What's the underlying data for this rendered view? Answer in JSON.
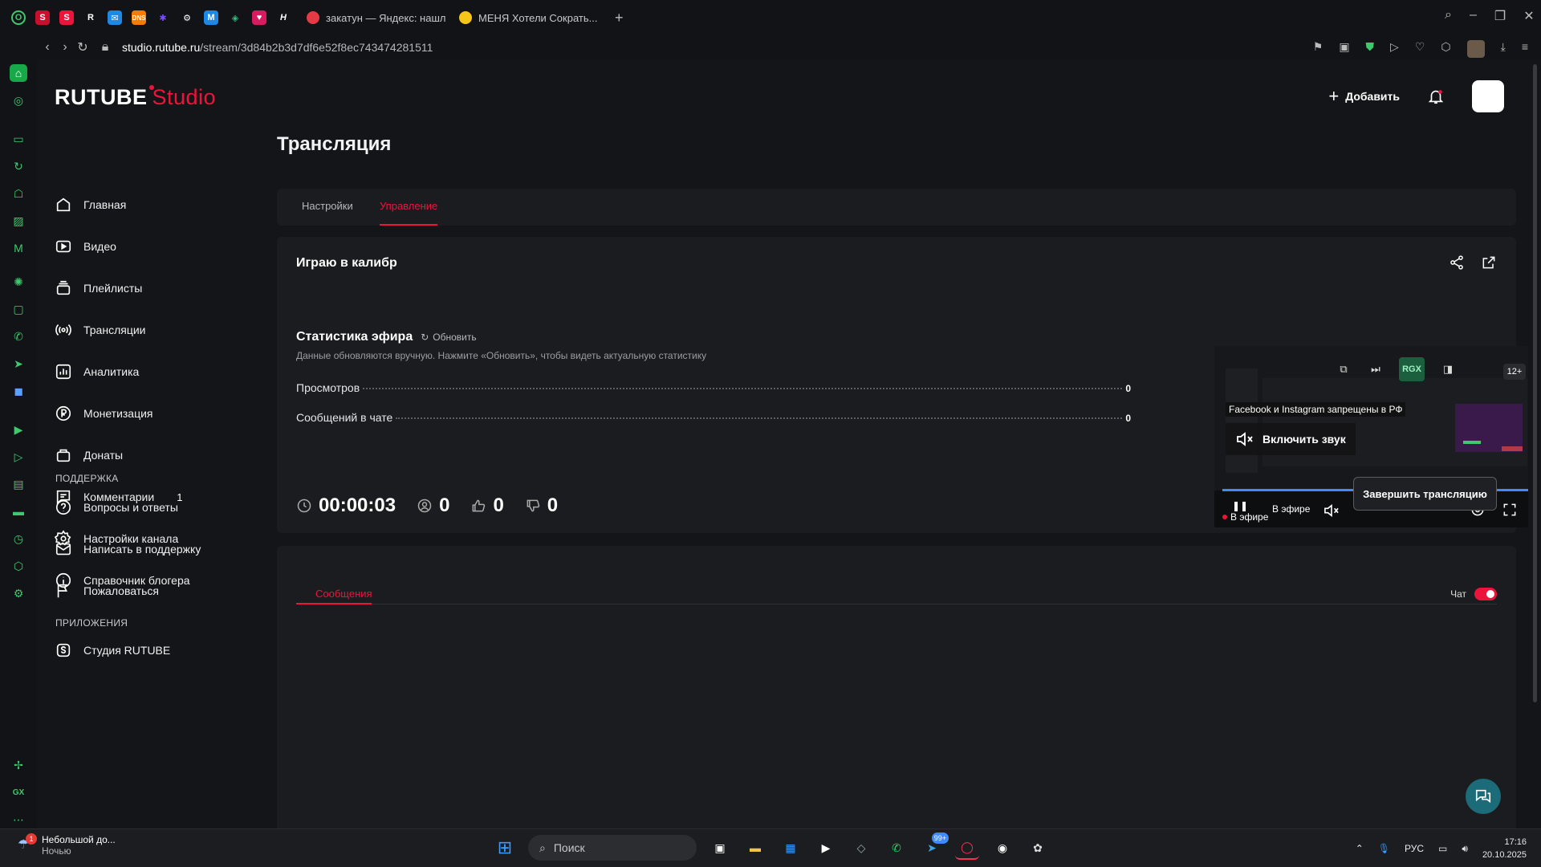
{
  "browser": {
    "tabs": [
      {
        "label": "закатун — Яндекс: нашл",
        "color": "#e63946"
      },
      {
        "label": "МЕНЯ Хотели Сократь...",
        "color": "#f5c518"
      }
    ],
    "url_domain": "studio.rutube.ru",
    "url_path": "/stream/3d84b2b3d7df6e52f8ec743474281511"
  },
  "brand": {
    "name": "RUTUBE",
    "suffix": "Studio",
    "accent": "#ed143b"
  },
  "header": {
    "add_label": "Добавить"
  },
  "sidebar": {
    "items": [
      {
        "label": "Главная",
        "icon": "home-icon"
      },
      {
        "label": "Видео",
        "icon": "video-icon"
      },
      {
        "label": "Плейлисты",
        "icon": "playlist-icon"
      },
      {
        "label": "Трансляции",
        "icon": "broadcast-icon"
      },
      {
        "label": "Аналитика",
        "icon": "analytics-icon"
      },
      {
        "label": "Монетизация",
        "icon": "money-icon"
      },
      {
        "label": "Донаты",
        "icon": "donate-icon"
      },
      {
        "label": "Комментарии",
        "icon": "comment-icon",
        "badge": "1"
      },
      {
        "label": "Настройки канала",
        "icon": "gear-icon"
      },
      {
        "label": "Справочник блогера",
        "icon": "info-icon"
      }
    ],
    "support_title": "ПОДДЕРЖКА",
    "support_items": [
      {
        "label": "Вопросы и ответы",
        "icon": "question-icon"
      },
      {
        "label": "Написать в поддержку",
        "icon": "mail-icon"
      },
      {
        "label": "Пожаловаться",
        "icon": "flag-icon"
      }
    ],
    "apps_title": "ПРИЛОЖЕНИЯ",
    "apps_items": [
      {
        "label": "Студия RUTUBE",
        "icon": "studio-icon"
      }
    ]
  },
  "page": {
    "title": "Трансляция",
    "tabs": [
      {
        "label": "Настройки",
        "active": false
      },
      {
        "label": "Управление",
        "active": true
      }
    ]
  },
  "stream": {
    "name": "Играю в калибр",
    "stats_title": "Статистика эфира",
    "refresh_label": "Обновить",
    "stats_note": "Данные обновляются вручную. Нажмите «Обновить», чтобы видеть актуальную статистику",
    "stats": [
      {
        "label": "Просмотров",
        "value": "0"
      },
      {
        "label": "Сообщений в чате",
        "value": "0"
      }
    ],
    "duration": "00:00:03",
    "viewers": "0",
    "likes": "0",
    "dislikes": "0",
    "end_label": "Завершить трансляцию"
  },
  "player": {
    "tooltip": "Facebook и Instagram запрещены в РФ",
    "unmute_label": "Включить звук",
    "live_label": "В эфире",
    "live_label_behind": "В эфире",
    "age_rating": "12+",
    "rgx_label": "RGX",
    "progress_percent": 100
  },
  "chat": {
    "tab_label": "Сообщения",
    "toggle_label": "Чат",
    "toggle_on": true
  },
  "taskbar": {
    "weather_title": "Небольшой до...",
    "weather_sub": "Ночью",
    "weather_badge": "1",
    "search_placeholder": "Поиск",
    "telegram_badge": "99+",
    "lang": "РУС",
    "time": "17:16",
    "date": "20.10.2025"
  }
}
